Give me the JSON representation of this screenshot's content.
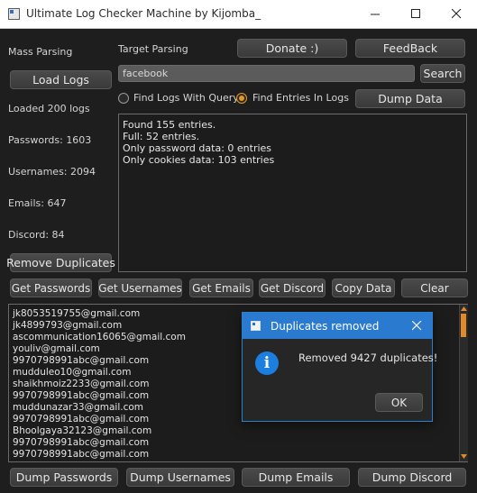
{
  "window": {
    "title": "Ultimate Log Checker Machine by Kijomba_",
    "controls": [
      "minimize-icon",
      "maximize-icon",
      "close-icon"
    ]
  },
  "mass_parsing": {
    "header": "Mass Parsing",
    "load_logs_label": "Load Logs",
    "loaded_text": "Loaded 200 logs",
    "passwords_text": "Passwords: 1603",
    "usernames_text": "Usernames: 2094",
    "emails_text": "Emails: 647",
    "discord_text": "Discord: 84",
    "remove_duplicates_label": "Remove Duplicates"
  },
  "target_parsing": {
    "header": "Target Parsing",
    "donate_label": "Donate :)",
    "feedback_label": "FeedBack",
    "search_value": "facebook",
    "search_label": "Search",
    "radio_query_label": "Find Logs With Query",
    "radio_entries_label": "Find Entries In Logs",
    "selected_radio": "entries",
    "dump_data_label": "Dump Data"
  },
  "results": {
    "lines": [
      "Found 155 entries.",
      "Full: 52 entries.",
      "Only password data: 0 entries",
      "Only cookies data: 103 entries"
    ]
  },
  "action_buttons": {
    "get_passwords": "Get Passwords",
    "get_usernames": "Get Usernames",
    "get_emails": "Get Emails",
    "get_discord": "Get Discord",
    "copy_data": "Copy Data",
    "clear": "Clear"
  },
  "output_list": {
    "lines": [
      "jk8053519755@gmail.com",
      "jk4899793@gmail.com",
      "ascommunication16065@gmail.com",
      "youliv@gmail.com",
      "9970798991abc@gmail.com",
      "mudduleo10@gmail.com",
      "shaikhmoiz2233@gmail.com",
      "9970798991abc@gmail.com",
      "muddunazar33@gmail.com",
      "9970798991abc@gmail.com",
      "Bhoolgaya32123@gmail.com",
      "9970798991abc@gmail.com",
      "9970798991abc@gmail.com"
    ]
  },
  "dump_buttons": {
    "dump_passwords": "Dump Passwords",
    "dump_usernames": "Dump Usernames",
    "dump_emails": "Dump Emails",
    "dump_discord": "Dump Discord"
  },
  "dialog": {
    "title": "Duplicates removed",
    "message": "Removed 9427 duplicates!",
    "ok_label": "OK",
    "icon": "info-icon"
  },
  "colors": {
    "accent_orange": "#e8962a",
    "dialog_blue": "#2a7bd0",
    "background": "#1e1e1e"
  }
}
